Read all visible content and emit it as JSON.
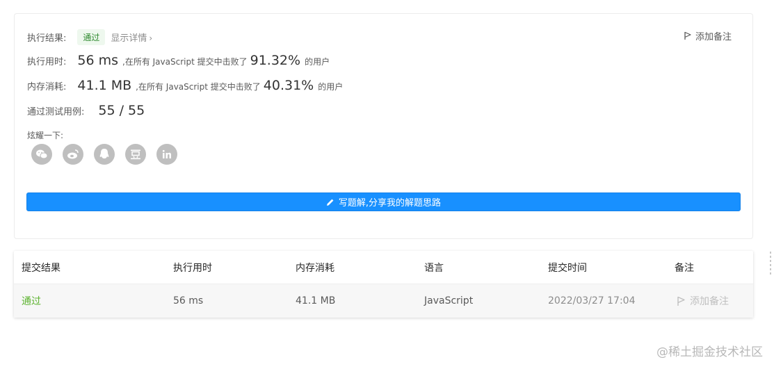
{
  "summary": {
    "result_label": "执行结果:",
    "result_value": "通过",
    "detail_link": "显示详情",
    "add_note": "添加备注",
    "time_label": "执行用时:",
    "time_value": "56 ms",
    "time_text": ",在所有 JavaScript 提交中击败了",
    "time_pct": "91.32%",
    "time_suffix": "的用户",
    "mem_label": "内存消耗:",
    "mem_value": "41.1 MB",
    "mem_text": ",在所有 JavaScript 提交中击败了",
    "mem_pct": "40.31%",
    "mem_suffix": "的用户",
    "cases_label": "通过测试用例:",
    "cases_value": "55 / 55",
    "share_label": "炫耀一下:",
    "share_icons": [
      "wechat-icon",
      "weibo-icon",
      "qq-icon",
      "douban-icon",
      "linkedin-icon"
    ],
    "write_solution": "写题解,分享我的解题思路"
  },
  "table": {
    "headers": [
      "提交结果",
      "执行用时",
      "内存消耗",
      "语言",
      "提交时间",
      "备注"
    ],
    "rows": [
      {
        "result": "通过",
        "time": "56 ms",
        "memory": "41.1 MB",
        "language": "JavaScript",
        "submitted": "2022/03/27 17:04",
        "note": "添加备注"
      }
    ]
  },
  "watermark": "@稀土掘金技术社区",
  "colors": {
    "accent": "#1890ff",
    "success": "#5cb32f",
    "icon_gray": "#bfbfbf"
  }
}
